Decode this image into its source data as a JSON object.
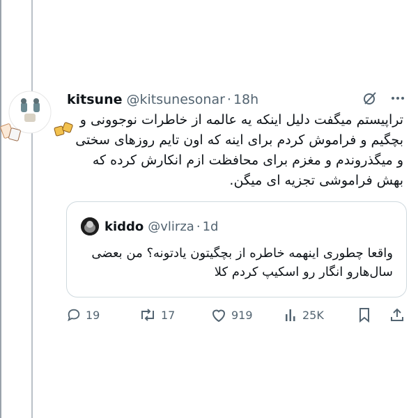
{
  "tweet": {
    "author_name": "kitsune",
    "handle": "@kitsunesonar",
    "separator": "·",
    "time": "18h",
    "text": "تراپیستم میگفت دلیل اینکه یه عالمه از خاطرات نوجوونی و بچگیم و فراموش کردم برای اینه که اون تایم روزهای سختی و میگذروندم و مغزم برای محافظت ازم انکارش کرده که بهش فراموشی تجزیه ای میگن."
  },
  "quoted_tweet": {
    "author_name": "kiddo",
    "handle": "@vlirza",
    "separator": "·",
    "time": "1d",
    "text": "واقعا چطوری اینهمه خاطره از بچگیتون یادتونه؟ من بعضی سال‌هارو انگار رو اسکیپ کردم کلا"
  },
  "actions": {
    "replies": "19",
    "retweets": "17",
    "likes": "919",
    "views": "25K"
  },
  "colors": {
    "text": "#0f1419",
    "muted": "#536471",
    "border": "#cfd9de"
  }
}
